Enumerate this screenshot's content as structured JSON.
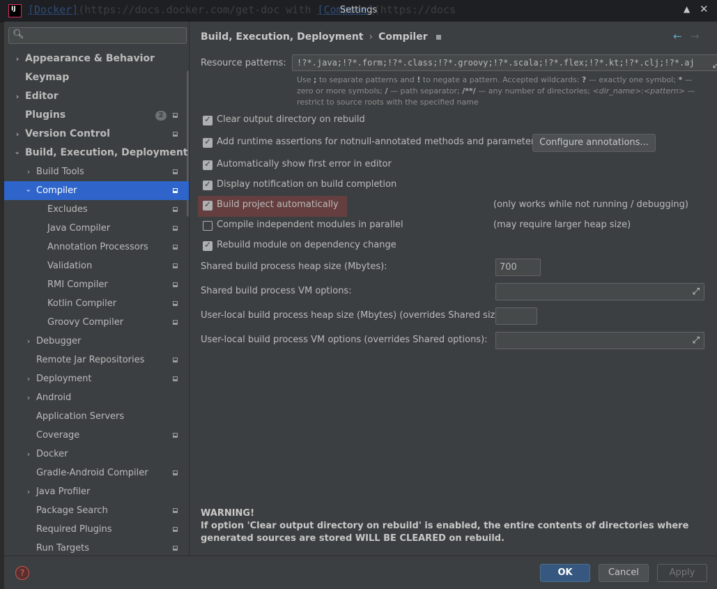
{
  "window": {
    "title": "Settings",
    "bg_text_1": "[Docker]",
    "bg_text_2": "(https://docs.docker.com/get-doc",
    "bg_text_3": " with ",
    "bg_text_4": "[Compose]",
    "bg_text_5": "(https://docs"
  },
  "sidebar": {
    "search_placeholder": "",
    "items": [
      {
        "label": "Appearance & Behavior"
      },
      {
        "label": "Keymap"
      },
      {
        "label": "Editor"
      },
      {
        "label": "Plugins",
        "badge": "2"
      },
      {
        "label": "Version Control"
      },
      {
        "label": "Build, Execution, Deployment"
      },
      {
        "label": "Build Tools"
      },
      {
        "label": "Compiler"
      },
      {
        "label": "Excludes"
      },
      {
        "label": "Java Compiler"
      },
      {
        "label": "Annotation Processors"
      },
      {
        "label": "Validation"
      },
      {
        "label": "RMI Compiler"
      },
      {
        "label": "Kotlin Compiler"
      },
      {
        "label": "Groovy Compiler"
      },
      {
        "label": "Debugger"
      },
      {
        "label": "Remote Jar Repositories"
      },
      {
        "label": "Deployment"
      },
      {
        "label": "Android"
      },
      {
        "label": "Application Servers"
      },
      {
        "label": "Coverage"
      },
      {
        "label": "Docker"
      },
      {
        "label": "Gradle-Android Compiler"
      },
      {
        "label": "Java Profiler"
      },
      {
        "label": "Package Search"
      },
      {
        "label": "Required Plugins"
      },
      {
        "label": "Run Targets"
      }
    ]
  },
  "breadcrumb": {
    "parent": "Build, Execution, Deployment",
    "separator": "›",
    "current": "Compiler"
  },
  "compiler": {
    "resource_patterns_label": "Resource patterns:",
    "resource_patterns_value": "!?*.java;!?*.form;!?*.class;!?*.groovy;!?*.scala;!?*.flex;!?*.kt;!?*.clj;!?*.aj",
    "help_1": "Use ",
    "help_semicolon": ";",
    "help_2": " to separate patterns and ",
    "help_bang": "!",
    "help_3": " to negate a pattern. Accepted wildcards: ",
    "help_q": "?",
    "help_4": " — exactly one symbol; ",
    "help_star": "*",
    "help_5": " — zero or more symbols; ",
    "help_slash": "/",
    "help_6": " — path separator; ",
    "help_dstar": "/**/",
    "help_7": " — any number of directories; ",
    "help_dir": "<dir_name>:<pattern>",
    "help_8": " — restrict to source roots with the specified name",
    "opt_clear_output": "Clear output directory on rebuild",
    "opt_runtime_assertions": "Add runtime assertions for notnull-annotated methods and parameters",
    "configure_annotations": "Configure annotations...",
    "opt_show_first_error": "Automatically show first error in editor",
    "opt_display_notification": "Display notification on build completion",
    "opt_build_automatically": "Build project automatically",
    "note_build_automatically": "(only works while not running / debugging)",
    "opt_compile_parallel": "Compile independent modules in parallel",
    "note_compile_parallel": "(may require larger heap size)",
    "opt_rebuild_module": "Rebuild module on dependency change",
    "shared_heap_label": "Shared build process heap size (Mbytes):",
    "shared_heap_value": "700",
    "shared_vm_label": "Shared build process VM options:",
    "shared_vm_value": "",
    "user_heap_label": "User-local build process heap size (Mbytes) (overrides Shared size):",
    "user_heap_value": "",
    "user_vm_label": "User-local build process VM options (overrides Shared options):",
    "user_vm_value": "",
    "warning_title": "WARNING!",
    "warning_text": "If option 'Clear output directory on rebuild' is enabled, the entire contents of directories where generated sources are stored WILL BE CLEARED on rebuild."
  },
  "footer": {
    "ok": "OK",
    "cancel": "Cancel",
    "apply": "Apply",
    "help_glyph": "?"
  },
  "colors": {
    "selection": "#2f65ca",
    "ok_button": "#365880",
    "highlight": "#6c3f3f"
  }
}
